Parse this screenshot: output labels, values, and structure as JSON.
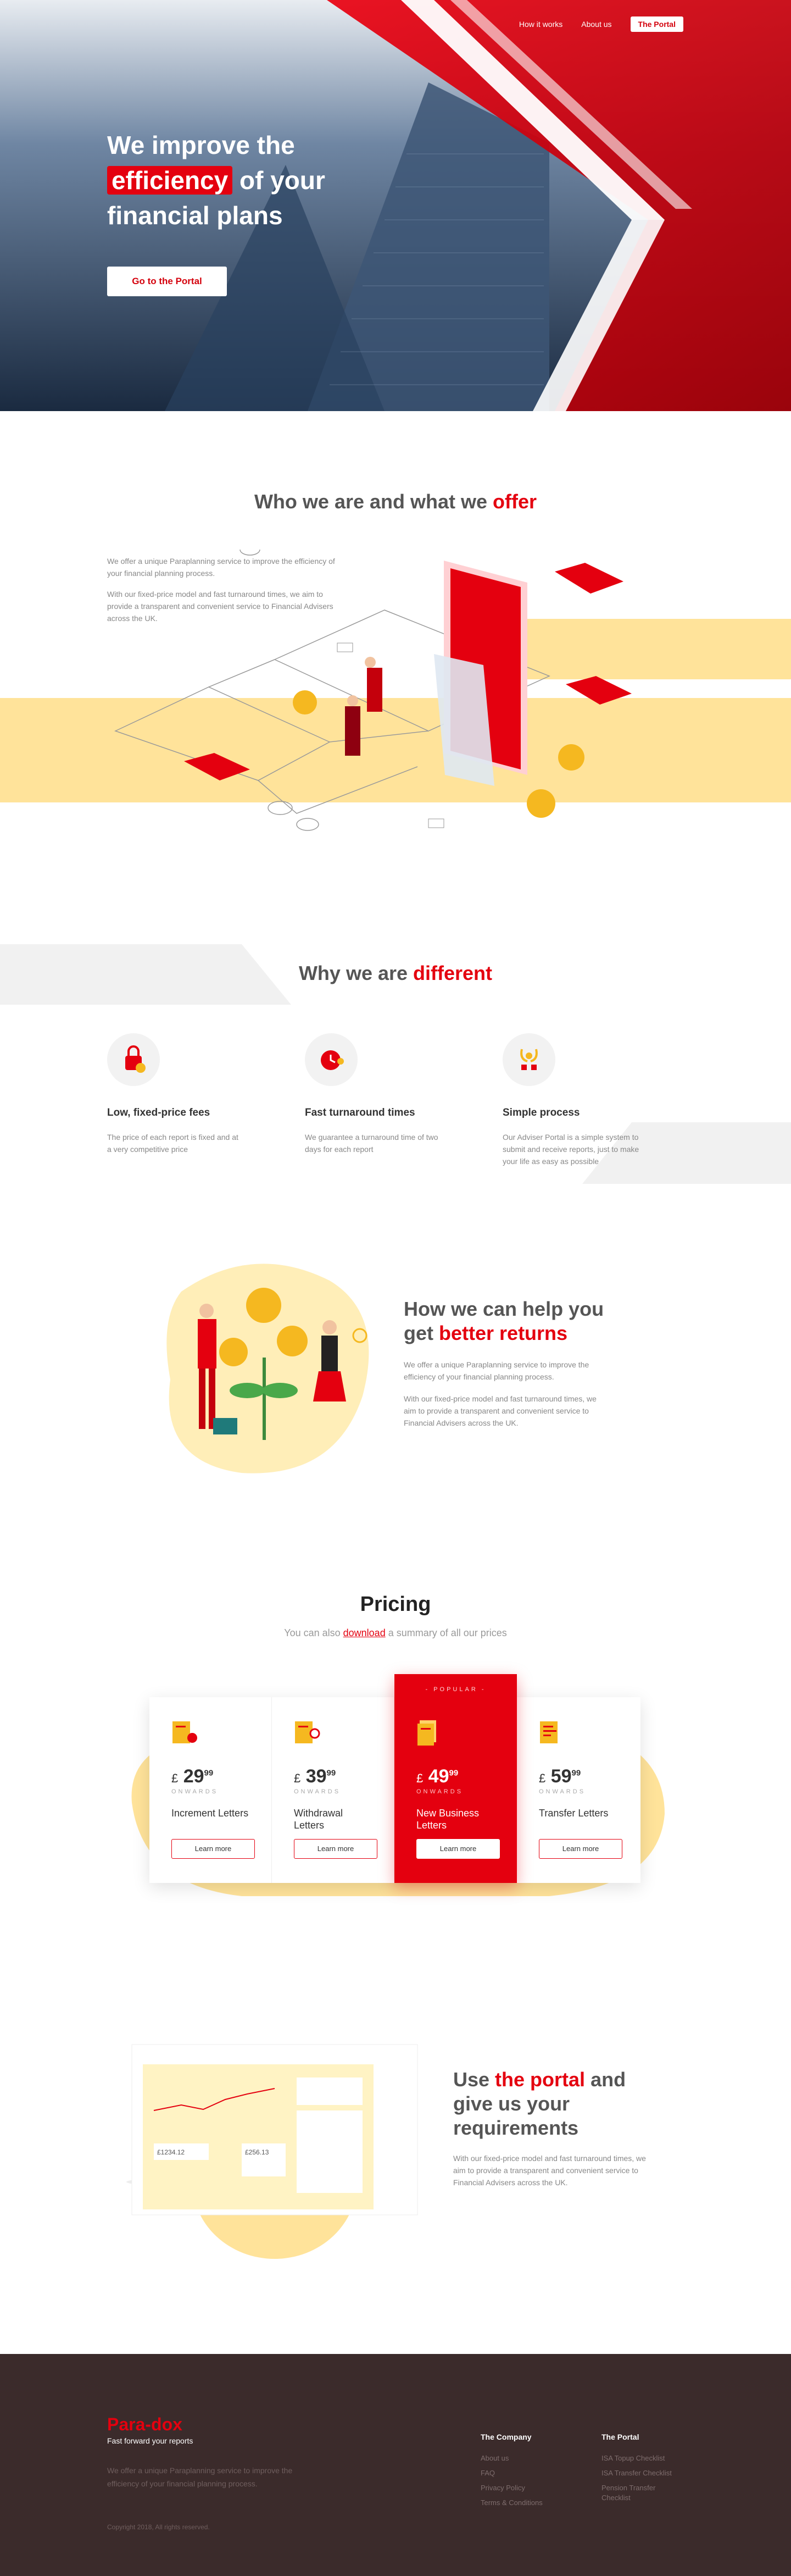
{
  "nav": {
    "how": "How it works",
    "about": "About us",
    "portal": "The Portal"
  },
  "hero": {
    "line1": "We improve the",
    "highlight": "efficiency",
    "line2_rest": " of your",
    "line3": "financial plans",
    "button": "Go to the Portal"
  },
  "who": {
    "title_plain": "Who we are and what we ",
    "title_red": "offer",
    "p1": "We offer a unique Paraplanning service to improve the efficiency of your financial planning process.",
    "p2": "With our fixed-price model and fast turnaround times, we aim to provide a transparent and convenient service to Financial Advisers across the UK."
  },
  "different": {
    "title_plain": "Why we are ",
    "title_red": "different",
    "cards": [
      {
        "title": "Low, fixed-price fees",
        "text": "The price of each report is fixed and at a very competitive price",
        "icon": "lock-coin-icon"
      },
      {
        "title": "Fast turnaround times",
        "text": "We guarantee a turnaround time of two days for each report",
        "icon": "clock-icon"
      },
      {
        "title": "Simple process",
        "text": "Our Adviser Portal is a simple system to submit and receive reports, just to make your life as easy as possible",
        "icon": "trophy-icon"
      }
    ]
  },
  "help": {
    "title_plain": "How we can help you get ",
    "title_red": "better returns",
    "p1": "We offer a unique Paraplanning service to improve the efficiency of your financial planning process.",
    "p2": "With our fixed-price model and fast turnaround times, we aim to provide a transparent and convenient service to Financial Advisers across the UK."
  },
  "pricing": {
    "title": "Pricing",
    "sub_before": "You can also ",
    "sub_link": "download",
    "sub_after": " a summary of all our prices",
    "popular_label": "- POPULAR -",
    "plans": [
      {
        "currency": "£",
        "price": "29",
        "cents": "99",
        "onwards": "ONWARDS",
        "name": "Increment Letters",
        "cta": "Learn more"
      },
      {
        "currency": "£",
        "price": "39",
        "cents": "99",
        "onwards": "ONWARDS",
        "name": "Withdrawal Letters",
        "cta": "Learn more"
      },
      {
        "currency": "£",
        "price": "49",
        "cents": "99",
        "onwards": "ONWARDS",
        "name": "New Business Letters",
        "cta": "Learn more"
      },
      {
        "currency": "£",
        "price": "59",
        "cents": "99",
        "onwards": "ONWARDS",
        "name": "Transfer Letters",
        "cta": "Learn more"
      }
    ]
  },
  "portal": {
    "title_a": "Use ",
    "title_red": "the portal",
    "title_b": " and give us your requirements",
    "p": "With our fixed-price model and fast turnaround times, we aim to provide a transparent and convenient service to Financial Advisers across the UK.",
    "dashboard_value": "£1234.12",
    "dashboard_value2": "£256.13"
  },
  "footer": {
    "logo": "Para-dox",
    "tagline": "Fast forward your reports",
    "desc": "We offer a unique Paraplanning service to improve the efficiency of your financial planning process.",
    "copyright": "Copyright 2018, All rights reserved.",
    "company": {
      "title": "The Company",
      "links": [
        "About us",
        "FAQ",
        "Privacy Policy",
        "Terms & Conditions"
      ]
    },
    "portal": {
      "title": "The Portal",
      "links": [
        "ISA Topup Checklist",
        "ISA Transfer Checklist",
        "Pension Transfer Checklist"
      ]
    }
  },
  "colors": {
    "brand": "#e4000f",
    "yellow": "#ffe39a",
    "footer": "#3b2b2b"
  }
}
